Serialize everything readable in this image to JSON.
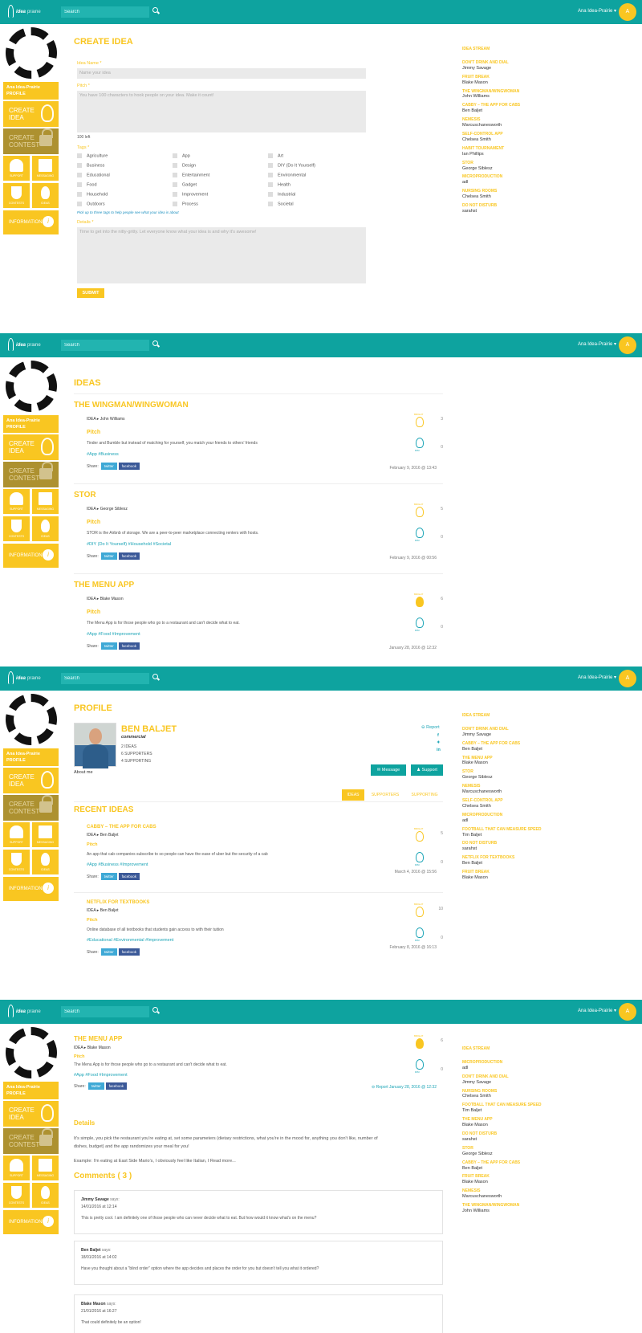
{
  "app": {
    "brand": "idea",
    "brand_suffix": "prairie",
    "search_placeholder": "Search",
    "user_name": "Ana Idea-Prairie ▾",
    "avatar_initial": "A"
  },
  "colors": {
    "teal": "#0ea39f",
    "yellow": "#f9c621",
    "muted": "#ad9130"
  },
  "sidebar": {
    "user_label_line1": "Ana Idea-Prairie",
    "user_label_line2": "PROFILE",
    "create_idea": "CREATE IDEA",
    "create_contest": "CREATE CONTEST",
    "support": "SUPPORT",
    "messaging": "MESSAGING",
    "contests": "CONTESTS",
    "ideas": "IDEAS",
    "information": "INFORMATION"
  },
  "create": {
    "title": "CREATE IDEA",
    "name_label": "Idea Name *",
    "name_placeholder": "Name your idea",
    "pitch_label": "Pitch *",
    "pitch_placeholder": "You have 100 characters to hook people on your idea. Make it count!",
    "chars_left": "100 left",
    "tags_label": "Tags *",
    "tags": [
      "Agriculture",
      "App",
      "Art",
      "Business",
      "Design",
      "DIY (Do It Yourself)",
      "Educational",
      "Entertainment",
      "Environmental",
      "Food",
      "Gadget",
      "Health",
      "Household",
      "Improvement",
      "Industrial",
      "Outdoors",
      "Process",
      "Societal"
    ],
    "tags_hint": "Pick up to three tags to help people see what your idea is about",
    "details_label": "Details *",
    "details_placeholder": "Time to get into the nitty-gritty. Let everyone know what your idea is and why it's awesome!",
    "submit": "SUBMIT"
  },
  "stream1": {
    "heading": "IDEA STREAM",
    "items": [
      {
        "title": "DON'T DRINK AND DIAL",
        "user": "Jimmy Savage"
      },
      {
        "title": "FRUIT BREAK",
        "user": "Blake Mason"
      },
      {
        "title": "THE WINGMAN/WINGWOMAN",
        "user": "John Williams"
      },
      {
        "title": "CABBY – THE APP FOR CABS",
        "user": "Ben Baljet"
      },
      {
        "title": "NEMESIS",
        "user": "Marcuschanesworth"
      },
      {
        "title": "SELF-CONTROL APP",
        "user": "Chelsea Smith"
      },
      {
        "title": "HABIT TOURNAMENT",
        "user": "Ian Phillips"
      },
      {
        "title": "STOR",
        "user": "George Siblesz"
      },
      {
        "title": "MICROPRODUCTION",
        "user": "adl"
      },
      {
        "title": "NURSING ROOMS",
        "user": "Chelsea Smith"
      },
      {
        "title": "DO NOT DISTURB",
        "user": "sarahst"
      }
    ]
  },
  "ideas_page": {
    "title": "IDEAS",
    "label_idea": "IDEA",
    "pitch_label": "Pitch",
    "share_label": "Share:",
    "twitter": "twitter",
    "facebook": "facebook",
    "bright_label": "BRIGHT",
    "dim_label": "DIM",
    "items": [
      {
        "title": "THE WINGMAN/WINGWOMAN",
        "author": "John Williams",
        "pitch": "Tinder and Bumble but instead of matching for yourself, you match your friends to others' friends",
        "tags": "#App #Business",
        "date": "February 9, 2016 @ 13:43",
        "bright": "3",
        "dim": "0"
      },
      {
        "title": "STOR",
        "author": "George Siblesz",
        "pitch": "STOR is the Airbnb of storage. We are a peer-to-peer marketplace connecting renters with hosts.",
        "tags": "#DIY (Do It Yourself) #Household #Societal",
        "date": "February 9, 2016 @ 00:56",
        "bright": "5",
        "dim": "0"
      },
      {
        "title": "THE MENU APP",
        "author": "Blake Mason",
        "pitch": "The Menu App is for those people who go to a restaurant and can't decide what to eat.",
        "tags": "#App #Food #Improvement",
        "date": "January 28, 2016 @ 12:32",
        "bright": "6",
        "dim": "0"
      }
    ]
  },
  "profile_page": {
    "title": "PROFILE",
    "name": "BEN BALJET",
    "role": "commercial",
    "stats": [
      "2 IDEAS",
      "6 SUPPORTERS",
      "4 SUPPORTING"
    ],
    "about": "About me",
    "report": "Report",
    "message_btn": "Message",
    "support_btn": "Support",
    "tabs": [
      "IDEAS",
      "SUPPORTERS",
      "SUPPORTING"
    ],
    "recent_title": "RECENT IDEAS",
    "items": [
      {
        "title": "CABBY – THE APP FOR CABS",
        "author": "Ben Baljet",
        "pitch": "An app that cab companies subscribe to so people can have the ease of uber but the security of a cab",
        "tags": "#App #Business #Improvement",
        "date": "March 4, 2016 @ 15:56",
        "bright": "5",
        "dim": "0"
      },
      {
        "title": "NETFLIX FOR TEXTBOOKS",
        "author": "Ben Baljet",
        "pitch": "Online database of all textbooks that students gain access to with their tuition",
        "tags": "#Educational #Environmental #Improvement",
        "date": "February 8, 2016 @ 16:13",
        "bright": "10",
        "dim": "0"
      }
    ]
  },
  "stream2": {
    "heading": "IDEA STREAM",
    "items": [
      {
        "title": "DON'T DRINK AND DIAL",
        "user": "Jimmy Savage"
      },
      {
        "title": "CABBY – THE APP FOR CABS",
        "user": "Ben Baljet"
      },
      {
        "title": "THE MENU APP",
        "user": "Blake Mason"
      },
      {
        "title": "STOR",
        "user": "George Siblesz"
      },
      {
        "title": "NEMESIS",
        "user": "Marcuschanesworth"
      },
      {
        "title": "SELF-CONTROL APP",
        "user": "Chelsea Smith"
      },
      {
        "title": "MICROPRODUCTION",
        "user": "adl"
      },
      {
        "title": "FOOTBALL THAT CAN MEASURE SPEED",
        "user": "Tim Baljet"
      },
      {
        "title": "DO NOT DISTURB",
        "user": "sarahst"
      },
      {
        "title": "NETFLIX FOR TEXTBOOKS",
        "user": "Ben Baljet"
      },
      {
        "title": "FRUIT BREAK",
        "user": "Blake Mason"
      }
    ]
  },
  "detail_page": {
    "title": "THE MENU APP",
    "author": "Blake Mason",
    "pitch": "The Menu App is for those people who go to a restaurant and can't decide what to eat.",
    "tags": "#App #Food #Improvement",
    "report_date": "Report January 28, 2016 @ 12:32",
    "bright": "6",
    "dim": "0",
    "details_title": "Details",
    "details_text1": "It's simple, you pick the restaurant you're eating at, set some parameters (dietary restrictions, what you're in the mood for, anything you don't like, number of",
    "details_text2": "dishes, budget) and the app randomizes your meal for you!",
    "details_text3": "Example: I'm eating at East Side Mario's, I obviously feel like Italian, I Read more...",
    "comments_title": "Comments ( 3 )",
    "says": "says:",
    "comments": [
      {
        "author": "Jimmy Savage",
        "date": "14/01/2016 at 12:14",
        "text": "This is pretty cool. I am definitely one of those people who can never decide what to eat. But how would it know what's on the menu?"
      },
      {
        "author": "Ben Baljet",
        "date": "18/01/2016 at 14:02",
        "text": "Have you thought about a \"blind order\" option where the app decides and places the order for you but doesn't tell you what it ordered?"
      },
      {
        "author": "Blake Mason",
        "date": "21/01/2016 at 16:27",
        "text": "That could definitely be an option!"
      }
    ]
  },
  "stream3": {
    "heading": "IDEA STREAM",
    "items": [
      {
        "title": "MICROPRODUCTION",
        "user": "adl"
      },
      {
        "title": "DON'T DRINK AND DIAL",
        "user": "Jimmy Savage"
      },
      {
        "title": "NURSING ROOMS",
        "user": "Chelsea Smith"
      },
      {
        "title": "FOOTBALL THAT CAN MEASURE SPEED",
        "user": "Tim Baljet"
      },
      {
        "title": "THE MENU APP",
        "user": "Blake Mason"
      },
      {
        "title": "DO NOT DISTURB",
        "user": "sarahst"
      },
      {
        "title": "STOR",
        "user": "George Siblesz"
      },
      {
        "title": "CABBY – THE APP FOR CABS",
        "user": "Ben Baljet"
      },
      {
        "title": "FRUIT BREAK",
        "user": "Blake Mason"
      },
      {
        "title": "NEMESIS",
        "user": "Marcuschanesworth"
      },
      {
        "title": "THE WINGMAN/WINGWOMAN",
        "user": "John Williams"
      }
    ]
  }
}
